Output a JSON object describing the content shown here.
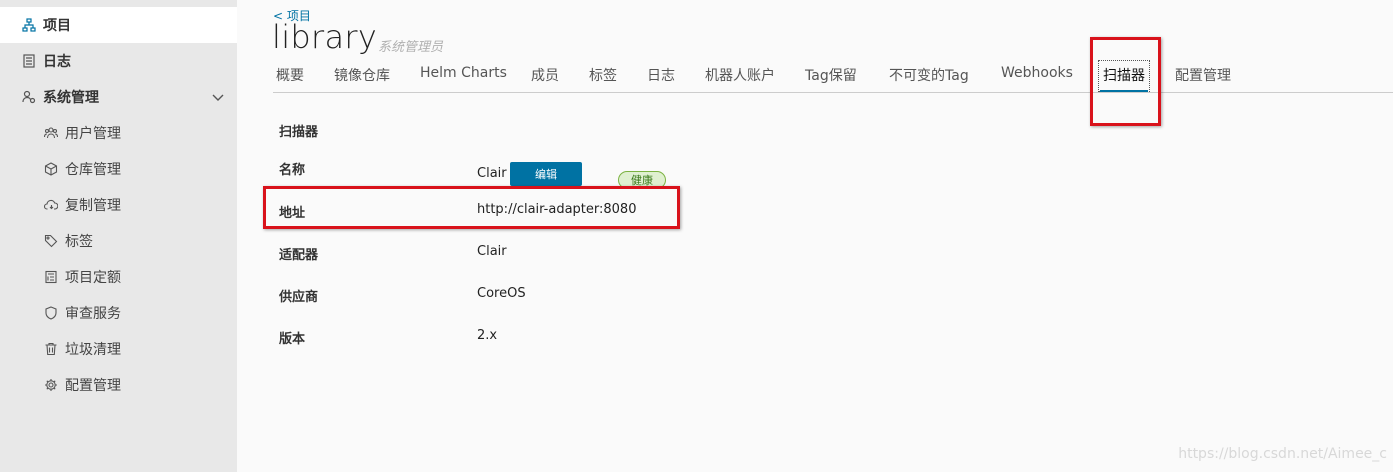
{
  "sidebar": {
    "projects": "项目",
    "logs": "日志",
    "system_admin": "系统管理",
    "items": [
      {
        "label": "用户管理"
      },
      {
        "label": "仓库管理"
      },
      {
        "label": "复制管理"
      },
      {
        "label": "标签"
      },
      {
        "label": "项目定额"
      },
      {
        "label": "审查服务"
      },
      {
        "label": "垃圾清理"
      },
      {
        "label": "配置管理"
      }
    ]
  },
  "header": {
    "breadcrumb": "< 项目",
    "title": "library",
    "role": "系统管理员"
  },
  "tabs": [
    {
      "label": "概要"
    },
    {
      "label": "镜像仓库"
    },
    {
      "label": "Helm Charts"
    },
    {
      "label": "成员"
    },
    {
      "label": "标签"
    },
    {
      "label": "日志"
    },
    {
      "label": "机器人账户"
    },
    {
      "label": "Tag保留"
    },
    {
      "label": "不可变的Tag"
    },
    {
      "label": "Webhooks"
    },
    {
      "label": "扫描器"
    },
    {
      "label": "配置管理"
    }
  ],
  "scanner": {
    "section_title": "扫描器",
    "name_label": "名称",
    "name_value": "Clair",
    "edit_label": "编辑",
    "health_label": "健康",
    "address_label": "地址",
    "address_value": "http://clair-adapter:8080",
    "adapter_label": "适配器",
    "adapter_value": "Clair",
    "vendor_label": "供应商",
    "vendor_value": "CoreOS",
    "version_label": "版本",
    "version_value": "2.x"
  },
  "watermark": "https://blog.csdn.net/Aimee_c",
  "colors": {
    "accent": "#0072a3",
    "highlight": "#d9121b",
    "health": "#7cb342"
  }
}
